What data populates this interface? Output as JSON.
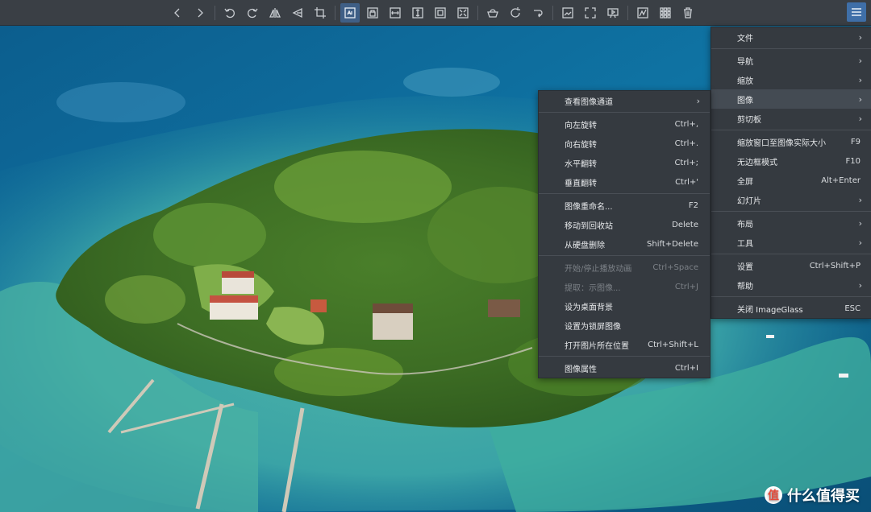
{
  "toolbar": {
    "icons": [
      "back-icon",
      "forward-icon",
      "rotate-left-icon",
      "rotate-right-icon",
      "flip-horizontal-icon",
      "flip-vertical-icon",
      "crop-icon",
      "zoom-auto-icon",
      "zoom-lock-icon",
      "scale-width-icon",
      "scale-height-icon",
      "scale-to-fit-icon",
      "scale-to-fill-icon",
      "open-icon",
      "refresh-icon",
      "redo-icon",
      "gallery-icon",
      "fullscreen-icon",
      "slideshow-icon",
      "edit-icon",
      "thumbnail-icon",
      "delete-icon"
    ],
    "menu_icon": "hamburger-menu-icon",
    "active_color": "#3f5f86"
  },
  "main_menu": {
    "items": [
      {
        "label": "文件",
        "shortcut": "",
        "submenu": true
      },
      {
        "label": "导航",
        "shortcut": "",
        "submenu": true
      },
      {
        "label": "缩放",
        "shortcut": "",
        "submenu": true
      },
      {
        "label": "图像",
        "shortcut": "",
        "submenu": true
      },
      {
        "label": "剪切板",
        "shortcut": "",
        "submenu": true
      },
      {
        "label": "缩放窗口至图像实际大小",
        "shortcut": "F9",
        "submenu": false
      },
      {
        "label": "无边框模式",
        "shortcut": "F10",
        "submenu": false
      },
      {
        "label": "全屏",
        "shortcut": "Alt+Enter",
        "submenu": false
      },
      {
        "label": "幻灯片",
        "shortcut": "",
        "submenu": true
      },
      {
        "label": "布局",
        "shortcut": "",
        "submenu": true
      },
      {
        "label": "工具",
        "shortcut": "",
        "submenu": true
      },
      {
        "label": "设置",
        "shortcut": "Ctrl+Shift+P",
        "submenu": false
      },
      {
        "label": "帮助",
        "shortcut": "",
        "submenu": true
      },
      {
        "label": "关闭 ImageGlass",
        "shortcut": "ESC",
        "submenu": false
      }
    ]
  },
  "image_menu": {
    "items": [
      {
        "label": "查看图像通道",
        "shortcut": "",
        "submenu": true
      },
      {
        "label": "向左旋转",
        "shortcut": "Ctrl+,"
      },
      {
        "label": "向右旋转",
        "shortcut": "Ctrl+."
      },
      {
        "label": "水平翻转",
        "shortcut": "Ctrl+;"
      },
      {
        "label": "垂直翻转",
        "shortcut": "Ctrl+'"
      },
      {
        "label": "图像重命名...",
        "shortcut": "F2"
      },
      {
        "label": "移动到回收站",
        "shortcut": "Delete"
      },
      {
        "label": "从硬盘删除",
        "shortcut": "Shift+Delete"
      },
      {
        "label": "开始/停止播放动画",
        "shortcut": "Ctrl+Space"
      },
      {
        "label": "提取：示图像...",
        "shortcut": "Ctrl+J"
      },
      {
        "label": "设为桌面背景",
        "shortcut": ""
      },
      {
        "label": "设置为锁屏图像",
        "shortcut": ""
      },
      {
        "label": "打开图片所在位置",
        "shortcut": "Ctrl+Shift+L"
      },
      {
        "label": "图像属性",
        "shortcut": "Ctrl+I"
      }
    ]
  },
  "watermark": {
    "logo": "值",
    "text": "什么值得买"
  }
}
